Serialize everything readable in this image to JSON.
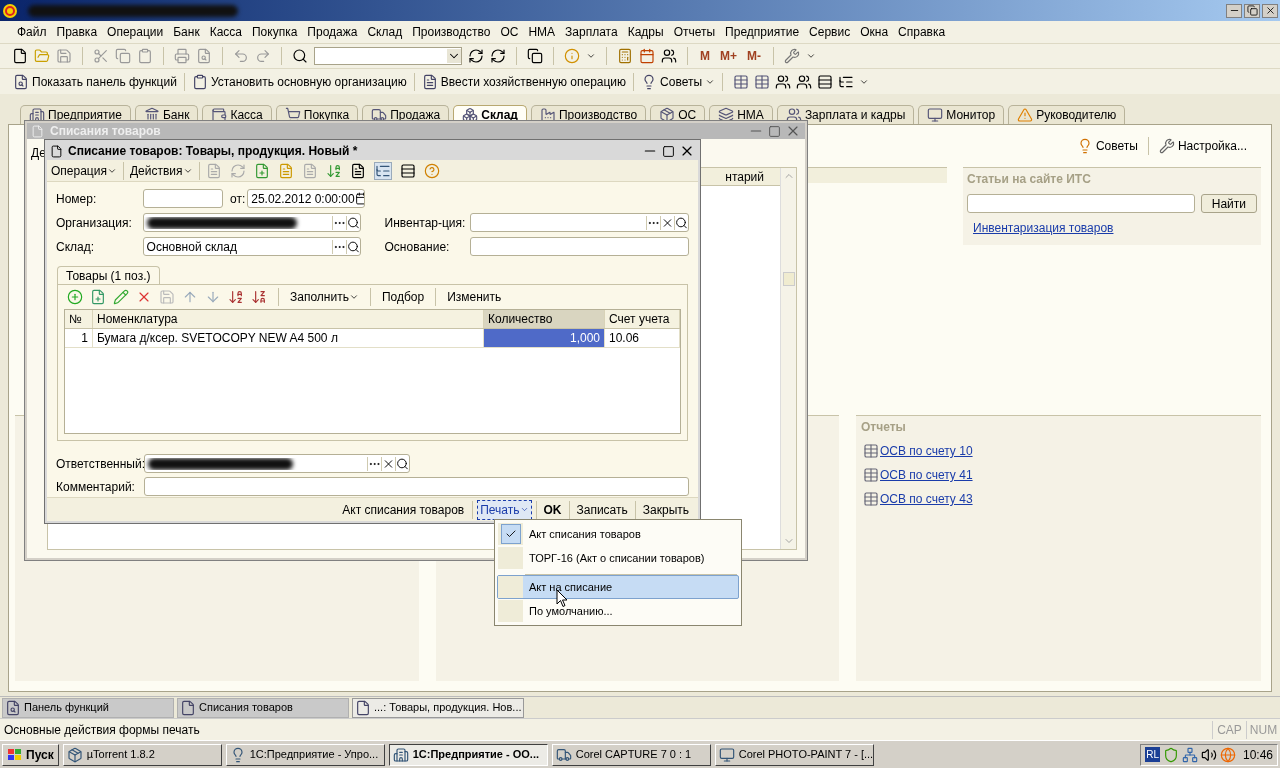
{
  "menu": [
    "Файл",
    "Правка",
    "Операции",
    "Банк",
    "Касса",
    "Покупка",
    "Продажа",
    "Склад",
    "Производство",
    "ОС",
    "НМА",
    "Зарплата",
    "Кадры",
    "Отчеты",
    "Предприятие",
    "Сервис",
    "Окна",
    "Справка"
  ],
  "toolbar": {
    "memory_buttons": [
      "M",
      "M+",
      "M-"
    ]
  },
  "command_bar": [
    {
      "label": "Показать панель функций",
      "dropdown": false
    },
    {
      "label": "Установить основную организацию",
      "dropdown": false
    },
    {
      "label": "Ввести хозяйственную операцию",
      "dropdown": false
    },
    {
      "label": "Советы",
      "dropdown": true
    }
  ],
  "section_tabs": [
    {
      "label": "Предприятие",
      "selected": false
    },
    {
      "label": "Банк",
      "selected": false
    },
    {
      "label": "Касса",
      "selected": false
    },
    {
      "label": "Покупка",
      "selected": false
    },
    {
      "label": "Продажа",
      "selected": false
    },
    {
      "label": "Склад",
      "selected": true
    },
    {
      "label": "Производство",
      "selected": false
    },
    {
      "label": "ОС",
      "selected": false
    },
    {
      "label": "НМА",
      "selected": false
    },
    {
      "label": "Зарплата и кадры",
      "selected": false
    },
    {
      "label": "Монитор",
      "selected": false
    },
    {
      "label": "Руководителю",
      "selected": false
    }
  ],
  "panel": {
    "tips": "Советы",
    "settings": "Настройка...",
    "its": {
      "title": "Статьи на сайте ИТС",
      "button": "Найти",
      "link": "Инвентаризация товаров"
    },
    "reports": {
      "title": "Отчеты",
      "links": [
        "ОСВ по счету 10",
        "ОСВ по счету 41",
        "ОСВ по счету 43"
      ]
    }
  },
  "list_window": {
    "title": "Списания товаров",
    "actions_partial": "Де",
    "column_partial": "нтарий"
  },
  "form": {
    "title": "Списание товаров: Товары, продукция. Новый *",
    "menus": [
      "Операция",
      "Действия"
    ],
    "number_label": "Номер:",
    "date_label": "от:",
    "date": "25.02.2012 0:00:00",
    "org_label": "Организация:",
    "inventory_label": "Инвентар-ция:",
    "warehouse_label": "Склад:",
    "warehouse": "Основной склад",
    "basis_label": "Основание:",
    "tab": "Товары (1 поз.)",
    "table_buttons": [
      {
        "label": "Заполнить",
        "dropdown": true
      },
      {
        "label": "Подбор",
        "dropdown": false
      },
      {
        "label": "Изменить",
        "dropdown": false
      }
    ],
    "columns": [
      {
        "label": "№",
        "selected": false
      },
      {
        "label": "Номенклатура",
        "selected": false
      },
      {
        "label": "Количество",
        "selected": true
      },
      {
        "label": "Счет учета",
        "selected": false
      }
    ],
    "rows": [
      {
        "cells": [
          {
            "text": "1",
            "selected": false
          },
          {
            "text": "Бумага д/ксер. SVETOCOPY NEW A4 500 л",
            "selected": false
          },
          {
            "text": "1,000",
            "selected": true
          },
          {
            "text": "10.06",
            "selected": false
          }
        ]
      }
    ],
    "responsible_label": "Ответственный:",
    "comment_label": "Комментарий:",
    "footer": {
      "act": "Акт списания товаров",
      "print": "Печать",
      "ok": "OK",
      "save": "Записать",
      "close": "Закрыть"
    }
  },
  "print_menu": [
    {
      "kind": "item",
      "label": "Акт списания товаров",
      "checked": true,
      "selected": false
    },
    {
      "kind": "item",
      "label": "ТОРГ-16 (Акт о списании товаров)",
      "checked": false,
      "selected": false
    },
    {
      "kind": "separator"
    },
    {
      "kind": "item",
      "label": "Акт на списание",
      "checked": false,
      "selected": true
    },
    {
      "kind": "item",
      "label": "По умолчанию...",
      "checked": false,
      "selected": false
    }
  ],
  "window_bar": [
    {
      "label": "Панель функций",
      "selected": false
    },
    {
      "label": "Списания товаров",
      "selected": false
    },
    {
      "label": "...: Товары, продукция. Нов...",
      "selected": true
    }
  ],
  "status_bar": {
    "text": "Основные действия формы печать",
    "indicators": [
      "CAP",
      "NUM"
    ]
  },
  "taskbar": {
    "start": "Пуск",
    "tasks": [
      {
        "label": "µTorrent 1.8.2",
        "selected": false
      },
      {
        "label": "1С:Предприятие - Упро...",
        "selected": false
      },
      {
        "label": "1С:Предприятие - ОО...",
        "selected": true
      },
      {
        "label": "Corel CAPTURE 7 0 : 1",
        "selected": false
      },
      {
        "label": "Corel PHOTO-PAINT 7 - [...",
        "selected": false
      }
    ],
    "language": "RL",
    "clock": "10:46"
  }
}
